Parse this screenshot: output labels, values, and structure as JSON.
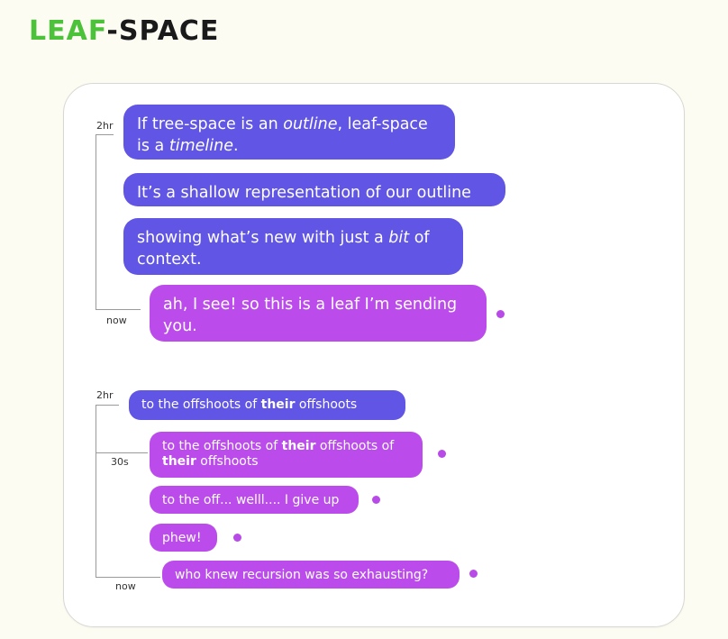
{
  "logo": {
    "leaf": "LEAF",
    "dash": "-",
    "space": "SPACE"
  },
  "thread1": {
    "start_label": "2hr",
    "end_label": "now",
    "messages": [
      {
        "parts": [
          [
            "If tree-space is an ",
            ""
          ],
          [
            "outline",
            "i"
          ],
          [
            ", leaf-space is a ",
            ""
          ],
          [
            "timeline",
            "i"
          ],
          [
            ".",
            ""
          ]
        ]
      },
      {
        "parts": [
          [
            "It’s a shallow representation of our outline",
            ""
          ]
        ]
      },
      {
        "parts": [
          [
            "showing what’s new with just a ",
            ""
          ],
          [
            "bit",
            "i"
          ],
          [
            " of context.",
            ""
          ]
        ]
      },
      {
        "parts": [
          [
            "ah, I see! so this is a leaf I’m sending you.",
            ""
          ]
        ]
      }
    ]
  },
  "thread2": {
    "start_label": "2hr",
    "mid_label": "30s",
    "end_label": "now",
    "messages": [
      {
        "parts": [
          [
            "to the offshoots of ",
            ""
          ],
          [
            "their",
            "b"
          ],
          [
            " offshoots",
            ""
          ]
        ]
      },
      {
        "parts": [
          [
            "to the offshoots of ",
            ""
          ],
          [
            "their",
            "b"
          ],
          [
            " offshoots of ",
            ""
          ],
          [
            "their",
            "b"
          ],
          [
            " offshoots",
            ""
          ]
        ]
      },
      {
        "parts": [
          [
            "to the off... welll.... I give up",
            ""
          ]
        ]
      },
      {
        "parts": [
          [
            "phew!",
            ""
          ]
        ]
      },
      {
        "parts": [
          [
            "who knew recursion was so exhausting?",
            ""
          ]
        ]
      }
    ]
  },
  "colors": {
    "sent_by_other": "#6055e4",
    "sent_by_me": "#bb4ceb",
    "unread_dot": "#b84ae8",
    "logo_green": "#4cc13a"
  }
}
